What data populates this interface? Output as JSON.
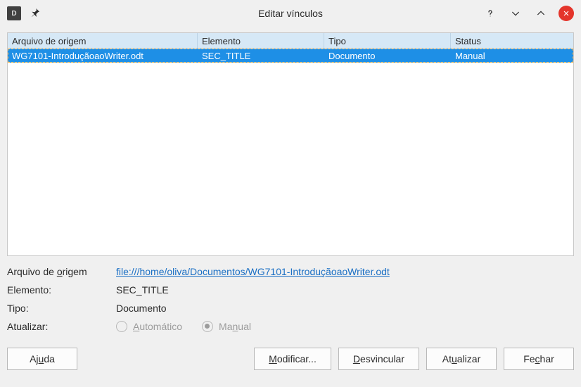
{
  "titlebar": {
    "title": "Editar vínculos"
  },
  "table": {
    "headers": {
      "source": "Arquivo de origem",
      "element": "Elemento",
      "type": "Tipo",
      "status": "Status"
    },
    "rows": [
      {
        "source": "WG7101-IntroduçãoaoWriter.odt",
        "element": "SEC_TITLE",
        "type": "Documento",
        "status": "Manual",
        "selected": true
      }
    ]
  },
  "details": {
    "source_label_pre": "Arquivo de ",
    "source_label_u": "o",
    "source_label_post": "rigem",
    "source_link": "file:///home/oliva/Documentos/WG7101-IntroduçãoaoWriter.odt",
    "element_label": "Elemento:",
    "element_value": "SEC_TITLE",
    "type_label": "Tipo:",
    "type_value": "Documento",
    "update_label": "Atualizar:",
    "radio_auto_u": "A",
    "radio_auto_post": "utomático",
    "radio_manual_pre": "Ma",
    "radio_manual_u": "n",
    "radio_manual_post": "ual"
  },
  "buttons": {
    "help_pre": "Aj",
    "help_u": "u",
    "help_post": "da",
    "modify_u": "M",
    "modify_post": "odificar...",
    "unlink_u": "D",
    "unlink_post": "esvincular",
    "update_pre": "At",
    "update_u": "u",
    "update_post": "alizar",
    "close_pre": "Fe",
    "close_u": "c",
    "close_post": "har"
  }
}
